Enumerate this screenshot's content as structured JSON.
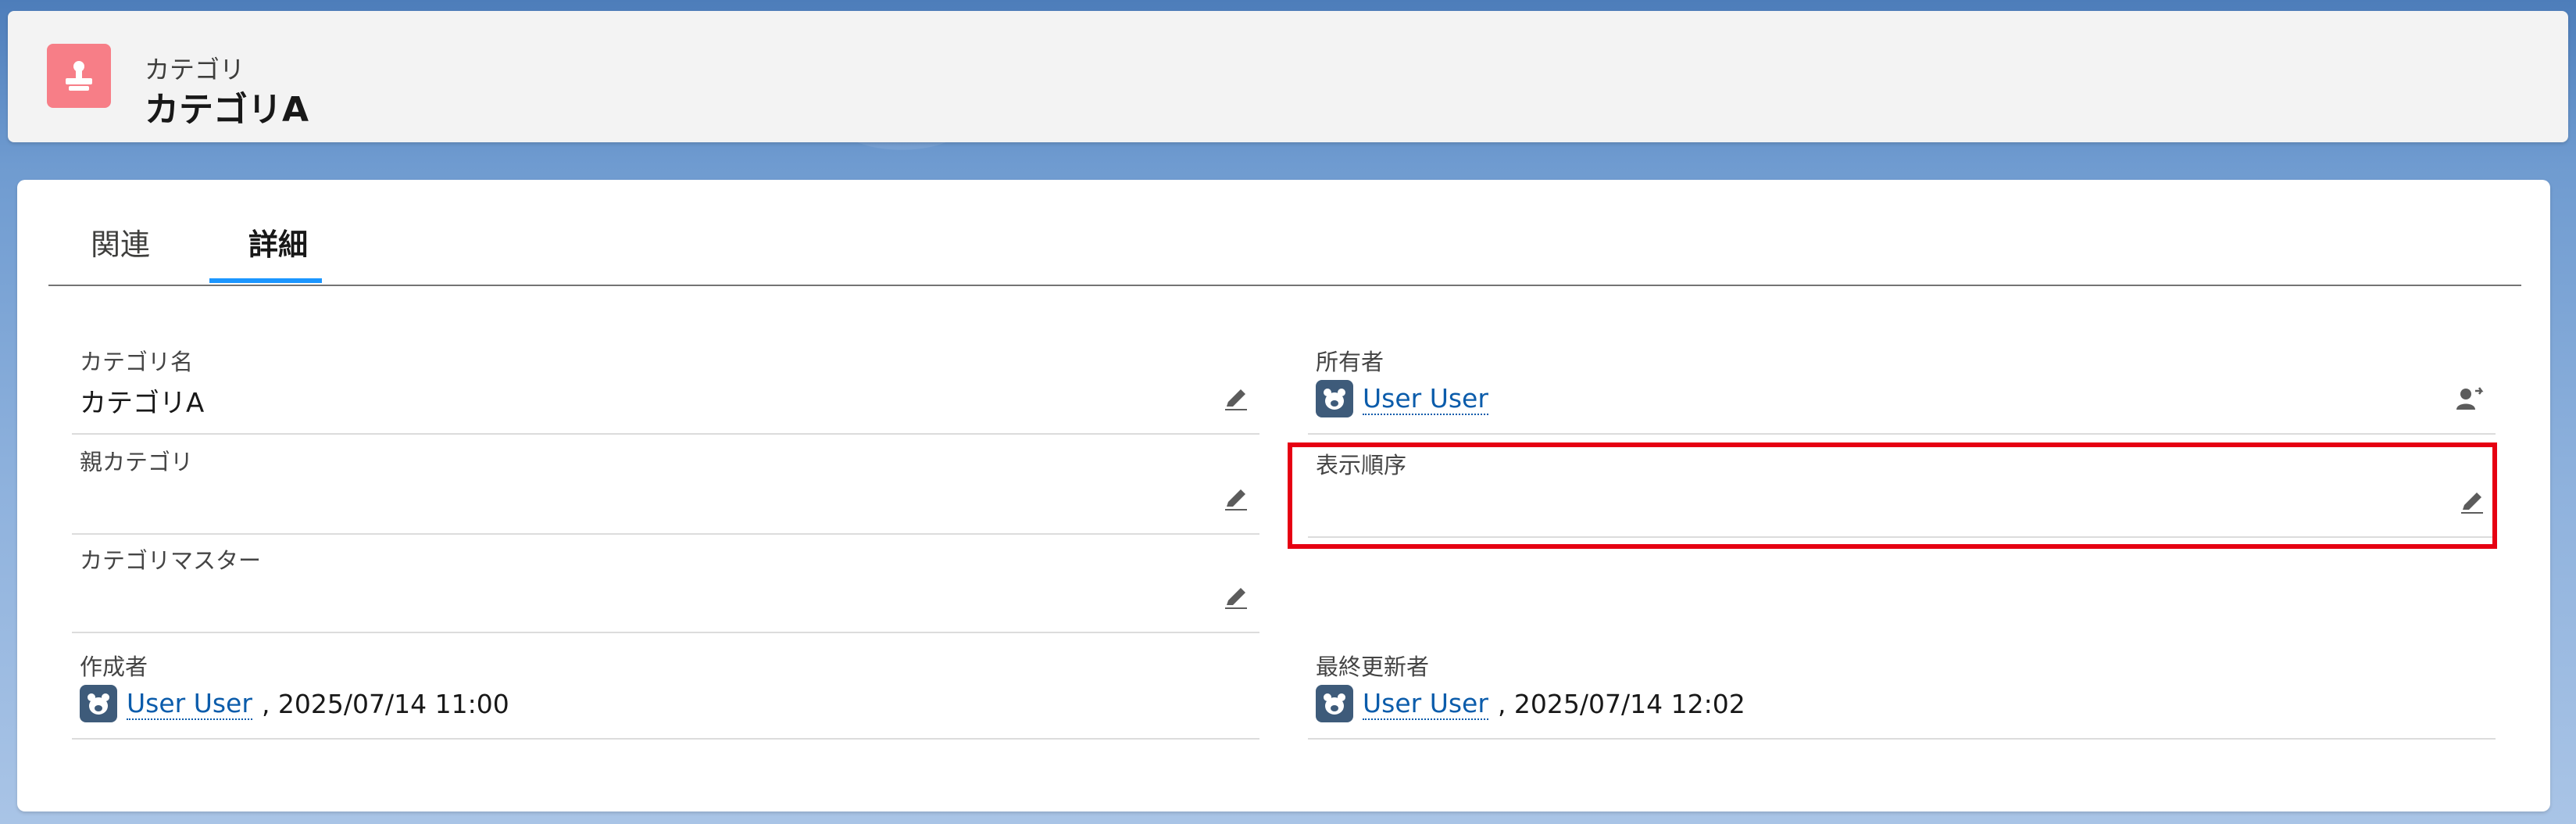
{
  "header": {
    "object_label": "カテゴリ",
    "record_name": "カテゴリA",
    "icon": "category-icon",
    "icon_color": "#f77e87"
  },
  "tabs": [
    {
      "label": "関連",
      "active": false
    },
    {
      "label": "詳細",
      "active": true
    }
  ],
  "fields": {
    "category_name": {
      "label": "カテゴリ名",
      "value": "カテゴリA"
    },
    "owner": {
      "label": "所有者",
      "user": "User User"
    },
    "parent_category": {
      "label": "親カテゴリ",
      "value": ""
    },
    "display_order": {
      "label": "表示順序",
      "value": ""
    },
    "category_master": {
      "label": "カテゴリマスター",
      "value": ""
    },
    "created_by": {
      "label": "作成者",
      "user": "User User",
      "datetime": ", 2025/07/14 11:00"
    },
    "last_modified_by": {
      "label": "最終更新者",
      "user": "User User",
      "datetime": ", 2025/07/14 12:02"
    }
  },
  "colors": {
    "accent": "#1b96ff",
    "link": "#0b5cab",
    "highlight": "#e60012"
  }
}
